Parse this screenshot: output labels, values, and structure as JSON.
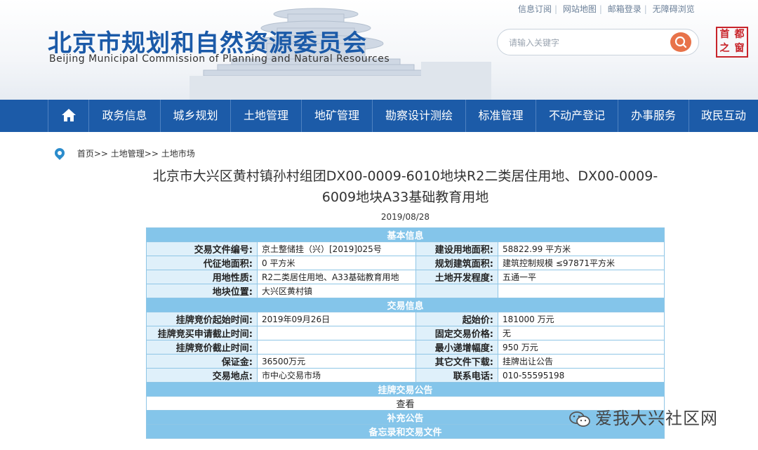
{
  "header": {
    "top_links": [
      "信息订阅",
      "网站地图",
      "邮箱登录",
      "无障碍浏览"
    ],
    "title": "北京市规划和自然资源委员会",
    "subtitle": "Beijing Municipal Commission of Planning and Natural Resources",
    "search_placeholder": "请输入关键字",
    "seal_chars": [
      "首",
      "都",
      "之",
      "窗"
    ]
  },
  "nav": {
    "home_icon": "home-icon",
    "items": [
      "政务信息",
      "城乡规划",
      "土地管理",
      "地矿管理",
      "勘察设计测绘",
      "标准管理",
      "不动产登记",
      "办事服务",
      "政民互动"
    ]
  },
  "breadcrumb": [
    "首页>>",
    "土地管理>>",
    "土地市场"
  ],
  "page": {
    "title": "北京市大兴区黄村镇孙村组团DX00-0009-6010地块R2二类居住用地、DX00-0009-6009地块A33基础教育用地",
    "date": "2019/08/28"
  },
  "table": {
    "section_basic": "基本信息",
    "section_trade": "交易信息",
    "section_notice": "挂牌交易公告",
    "view_label": "查看",
    "section_supplement": "补充公告",
    "section_memo": "备忘录和交易文件",
    "basic_rows": [
      [
        "交易文件编号:",
        "京土整储挂（兴）[2019]025号",
        "建设用地面积:",
        "58822.99 平方米"
      ],
      [
        "代征地面积:",
        "0 平方米",
        "规划建筑面积:",
        "建筑控制规模 ≤97871平方米"
      ],
      [
        "用地性质:",
        "R2二类居住用地、A33基础教育用地",
        "土地开发程度:",
        "五通一平"
      ],
      [
        "地块位置:",
        "大兴区黄村镇",
        "",
        ""
      ]
    ],
    "trade_rows": [
      [
        "挂牌竞价起始时间:",
        "2019年09月26日",
        "起始价:",
        "181000 万元"
      ],
      [
        "挂牌竞买申请截止时间:",
        "",
        "固定交易价格:",
        "无"
      ],
      [
        "挂牌竞价截止时间:",
        "",
        "最小递增幅度:",
        "950 万元"
      ],
      [
        "保证金:",
        "36500万元",
        "其它文件下载:",
        "挂牌出让公告"
      ],
      [
        "交易地点:",
        "市中心交易市场",
        "联系电话:",
        "010-55595198"
      ]
    ]
  },
  "watermark": "爱我大兴社区网"
}
